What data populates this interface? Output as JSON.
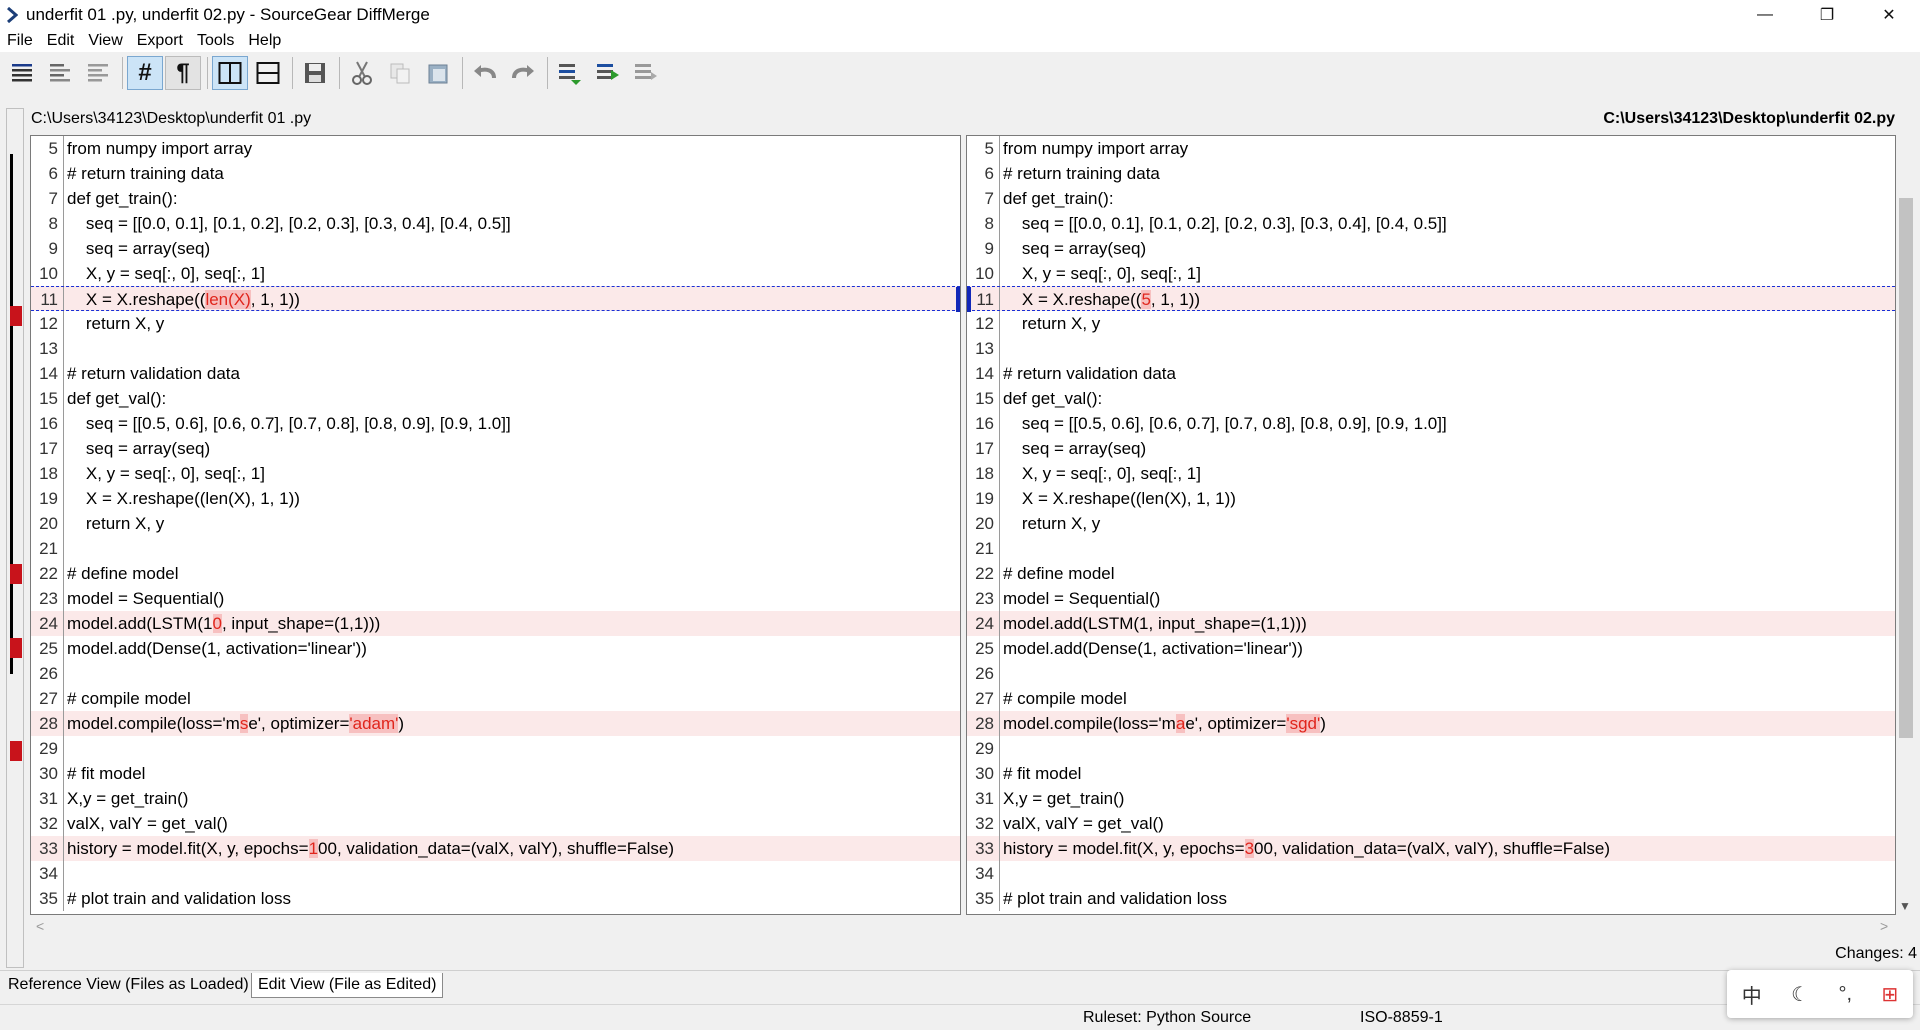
{
  "window": {
    "title": "underfit 01 .py, underfit 02.py - SourceGear DiffMerge",
    "minimize": "—",
    "restore": "❐",
    "close": "✕"
  },
  "menu": [
    "File",
    "Edit",
    "View",
    "Export",
    "Tools",
    "Help"
  ],
  "paths": {
    "left": "C:\\Users\\34123\\Desktop\\underfit 01 .py",
    "right": "C:\\Users\\34123\\Desktop\\underfit 02.py"
  },
  "left_lines": [
    {
      "n": "5",
      "segs": [
        [
          "from numpy import array",
          0
        ]
      ]
    },
    {
      "n": "6",
      "segs": [
        [
          "# return training data",
          0
        ]
      ]
    },
    {
      "n": "7",
      "segs": [
        [
          "def get_train():",
          0
        ]
      ]
    },
    {
      "n": "8",
      "segs": [
        [
          "    seq = [[0.0, 0.1], [0.1, 0.2], [0.2, 0.3], [0.3, 0.4], [0.4, 0.5]]",
          0
        ]
      ]
    },
    {
      "n": "9",
      "segs": [
        [
          "    seq = array(seq)",
          0
        ]
      ]
    },
    {
      "n": "10",
      "segs": [
        [
          "    X, y = seq[:, 0], seq[:, 1]",
          0
        ]
      ]
    },
    {
      "n": "11",
      "state": "current",
      "segs": [
        [
          "    X = X.reshape((",
          0
        ],
        [
          "len(X)",
          1
        ],
        [
          ", 1, 1))",
          0
        ]
      ]
    },
    {
      "n": "12",
      "segs": [
        [
          "    return X, y",
          0
        ]
      ]
    },
    {
      "n": "13",
      "segs": [
        [
          "",
          0
        ]
      ]
    },
    {
      "n": "14",
      "segs": [
        [
          "# return validation data",
          0
        ]
      ]
    },
    {
      "n": "15",
      "segs": [
        [
          "def get_val():",
          0
        ]
      ]
    },
    {
      "n": "16",
      "segs": [
        [
          "    seq = [[0.5, 0.6], [0.6, 0.7], [0.7, 0.8], [0.8, 0.9], [0.9, 1.0]]",
          0
        ]
      ]
    },
    {
      "n": "17",
      "segs": [
        [
          "    seq = array(seq)",
          0
        ]
      ]
    },
    {
      "n": "18",
      "segs": [
        [
          "    X, y = seq[:, 0], seq[:, 1]",
          0
        ]
      ]
    },
    {
      "n": "19",
      "segs": [
        [
          "    X = X.reshape((len(X), 1, 1))",
          0
        ]
      ]
    },
    {
      "n": "20",
      "segs": [
        [
          "    return X, y",
          0
        ]
      ]
    },
    {
      "n": "21",
      "segs": [
        [
          "",
          0
        ]
      ]
    },
    {
      "n": "22",
      "segs": [
        [
          "# define model",
          0
        ]
      ]
    },
    {
      "n": "23",
      "segs": [
        [
          "model = Sequential()",
          0
        ]
      ]
    },
    {
      "n": "24",
      "state": "changed",
      "segs": [
        [
          "model.add(LSTM(1",
          0
        ],
        [
          "0",
          1
        ],
        [
          ", input_shape=(1,1)))",
          0
        ]
      ]
    },
    {
      "n": "25",
      "segs": [
        [
          "model.add(Dense(1, activation='linear'))",
          0
        ]
      ]
    },
    {
      "n": "26",
      "segs": [
        [
          "",
          0
        ]
      ]
    },
    {
      "n": "27",
      "segs": [
        [
          "# compile model",
          0
        ]
      ]
    },
    {
      "n": "28",
      "state": "changed",
      "segs": [
        [
          "model.compile(loss='m",
          0
        ],
        [
          "s",
          1
        ],
        [
          "e', optimizer=",
          0
        ],
        [
          "'adam'",
          1
        ],
        [
          ")",
          0
        ]
      ]
    },
    {
      "n": "29",
      "segs": [
        [
          "",
          0
        ]
      ]
    },
    {
      "n": "30",
      "segs": [
        [
          "# fit model",
          0
        ]
      ]
    },
    {
      "n": "31",
      "segs": [
        [
          "X,y = get_train()",
          0
        ]
      ]
    },
    {
      "n": "32",
      "segs": [
        [
          "valX, valY = get_val()",
          0
        ]
      ]
    },
    {
      "n": "33",
      "state": "changed",
      "segs": [
        [
          "history = model.fit(X, y, epochs=",
          0
        ],
        [
          "1",
          1
        ],
        [
          "00, validation_data=(valX, valY), shuffle=False)",
          0
        ]
      ]
    },
    {
      "n": "34",
      "segs": [
        [
          "",
          0
        ]
      ]
    },
    {
      "n": "35",
      "segs": [
        [
          "# plot train and validation loss",
          0
        ]
      ]
    }
  ],
  "right_lines": [
    {
      "n": "5",
      "segs": [
        [
          "from numpy import array",
          0
        ]
      ]
    },
    {
      "n": "6",
      "segs": [
        [
          "# return training data",
          0
        ]
      ]
    },
    {
      "n": "7",
      "segs": [
        [
          "def get_train():",
          0
        ]
      ]
    },
    {
      "n": "8",
      "segs": [
        [
          "    seq = [[0.0, 0.1], [0.1, 0.2], [0.2, 0.3], [0.3, 0.4], [0.4, 0.5]]",
          0
        ]
      ]
    },
    {
      "n": "9",
      "segs": [
        [
          "    seq = array(seq)",
          0
        ]
      ]
    },
    {
      "n": "10",
      "segs": [
        [
          "    X, y = seq[:, 0], seq[:, 1]",
          0
        ]
      ]
    },
    {
      "n": "11",
      "state": "current",
      "segs": [
        [
          "    X = X.reshape((",
          0
        ],
        [
          "5",
          1
        ],
        [
          ", 1, 1))",
          0
        ]
      ]
    },
    {
      "n": "12",
      "segs": [
        [
          "    return X, y",
          0
        ]
      ]
    },
    {
      "n": "13",
      "segs": [
        [
          "",
          0
        ]
      ]
    },
    {
      "n": "14",
      "segs": [
        [
          "# return validation data",
          0
        ]
      ]
    },
    {
      "n": "15",
      "segs": [
        [
          "def get_val():",
          0
        ]
      ]
    },
    {
      "n": "16",
      "segs": [
        [
          "    seq = [[0.5, 0.6], [0.6, 0.7], [0.7, 0.8], [0.8, 0.9], [0.9, 1.0]]",
          0
        ]
      ]
    },
    {
      "n": "17",
      "segs": [
        [
          "    seq = array(seq)",
          0
        ]
      ]
    },
    {
      "n": "18",
      "segs": [
        [
          "    X, y = seq[:, 0], seq[:, 1]",
          0
        ]
      ]
    },
    {
      "n": "19",
      "segs": [
        [
          "    X = X.reshape((len(X), 1, 1))",
          0
        ]
      ]
    },
    {
      "n": "20",
      "segs": [
        [
          "    return X, y",
          0
        ]
      ]
    },
    {
      "n": "21",
      "segs": [
        [
          "",
          0
        ]
      ]
    },
    {
      "n": "22",
      "segs": [
        [
          "# define model",
          0
        ]
      ]
    },
    {
      "n": "23",
      "segs": [
        [
          "model = Sequential()",
          0
        ]
      ]
    },
    {
      "n": "24",
      "state": "changed",
      "segs": [
        [
          "model.add(LSTM(1, input_shape=(1,1)))",
          0
        ]
      ]
    },
    {
      "n": "25",
      "segs": [
        [
          "model.add(Dense(1, activation='linear'))",
          0
        ]
      ]
    },
    {
      "n": "26",
      "segs": [
        [
          "",
          0
        ]
      ]
    },
    {
      "n": "27",
      "segs": [
        [
          "# compile model",
          0
        ]
      ]
    },
    {
      "n": "28",
      "state": "changed",
      "segs": [
        [
          "model.compile(loss='m",
          0
        ],
        [
          "a",
          1
        ],
        [
          "e', optimizer=",
          0
        ],
        [
          "'sgd'",
          1
        ],
        [
          ")",
          0
        ]
      ]
    },
    {
      "n": "29",
      "segs": [
        [
          "",
          0
        ]
      ]
    },
    {
      "n": "30",
      "segs": [
        [
          "# fit model",
          0
        ]
      ]
    },
    {
      "n": "31",
      "segs": [
        [
          "X,y = get_train()",
          0
        ]
      ]
    },
    {
      "n": "32",
      "segs": [
        [
          "valX, valY = get_val()",
          0
        ]
      ]
    },
    {
      "n": "33",
      "state": "changed",
      "segs": [
        [
          "history = model.fit(X, y, epochs=",
          0
        ],
        [
          "3",
          1
        ],
        [
          "00, validation_data=(valX, valY), shuffle=False)",
          0
        ]
      ]
    },
    {
      "n": "34",
      "segs": [
        [
          "",
          0
        ]
      ]
    },
    {
      "n": "35",
      "segs": [
        [
          "# plot train and validation loss",
          0
        ]
      ]
    }
  ],
  "changes_label": "Changes: 4",
  "tabs": {
    "reference": "Reference View (Files as Loaded)",
    "edit": "Edit View (File as Edited)"
  },
  "status": {
    "ruleset": "Ruleset: Python Source",
    "encoding": "ISO-8859-1"
  },
  "ime": [
    "中",
    "☾",
    "°,",
    "⊞"
  ],
  "colors": {
    "diff_highlight": "#e0251c",
    "changed_line_bg": "#fbe9e9",
    "overview_mark": "#c8131b",
    "current_marker": "#1228b8"
  }
}
